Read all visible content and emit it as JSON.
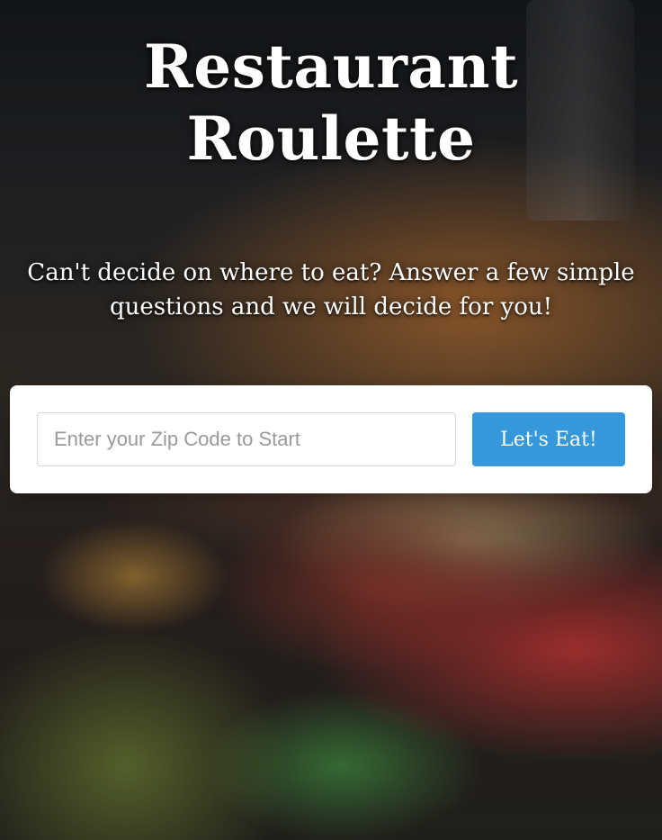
{
  "page": {
    "title": "Restaurant Roulette",
    "subtitle": "Can't decide on where to eat? Answer a few simple questions and we will decide for you!"
  },
  "form": {
    "zip_placeholder": "Enter your Zip Code to Start",
    "zip_value": "",
    "submit_label": "Let's Eat!"
  },
  "colors": {
    "button": "#3498db",
    "card": "#ffffff",
    "text": "#ffffff"
  }
}
